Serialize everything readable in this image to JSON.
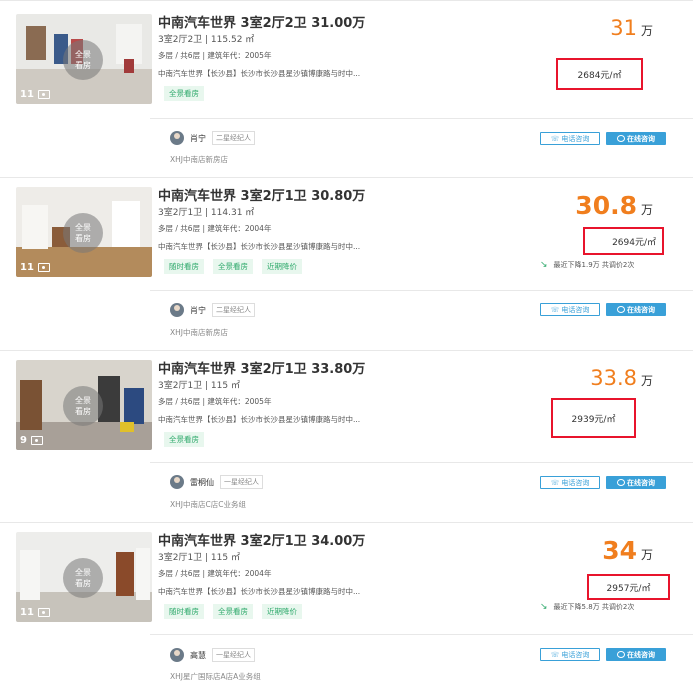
{
  "listings": [
    {
      "title": "中南汽车世界 3室2厅2卫 31.00万",
      "rooms": "3室2厅2卫 | 115.52 ㎡",
      "floor": "多层 / 共6层 | 建筑年代：2005年",
      "address": "中南汽车世界【长沙县】长沙市长沙县星沙镇博康路与时中...",
      "tags": [
        "全景看房"
      ],
      "photo_count": "11",
      "vr_label_line1": "全景",
      "vr_label_line2": "看房",
      "price": "31",
      "price_unit": "万",
      "unit_price": "2684元/㎡",
      "price_cut": "",
      "agent_name": "肖宁",
      "agent_level": "二星经纪人",
      "store": "XHJ中南店新房店",
      "phone_label": "电话咨询",
      "chat_label": "在线咨询"
    },
    {
      "title": "中南汽车世界 3室2厅1卫 30.80万",
      "rooms": "3室2厅1卫 | 114.31 ㎡",
      "floor": "多层 / 共6层 | 建筑年代：2004年",
      "address": "中南汽车世界【长沙县】长沙市长沙县星沙镇博康路与时中...",
      "tags": [
        "随时看房",
        "全景看房",
        "近期降价"
      ],
      "photo_count": "11",
      "vr_label_line1": "全景",
      "vr_label_line2": "看房",
      "price": "30.8",
      "price_unit": "万",
      "unit_price": "2694元/㎡",
      "price_cut": "最近下降1.9万  共调价2次",
      "agent_name": "肖宁",
      "agent_level": "二星经纪人",
      "store": "XHJ中南店新房店",
      "phone_label": "电话咨询",
      "chat_label": "在线咨询"
    },
    {
      "title": "中南汽车世界 3室2厅1卫 33.80万",
      "rooms": "3室2厅1卫 | 115 ㎡",
      "floor": "多层 / 共6层 | 建筑年代：2005年",
      "address": "中南汽车世界【长沙县】长沙市长沙县星沙镇博康路与时中...",
      "tags": [
        "全景看房"
      ],
      "photo_count": "9",
      "vr_label_line1": "全景",
      "vr_label_line2": "看房",
      "price": "33.8",
      "price_unit": "万",
      "unit_price": "2939元/㎡",
      "price_cut": "",
      "agent_name": "雷桐仙",
      "agent_level": "一星经纪人",
      "store": "XHJ中南店C店C业务组",
      "phone_label": "电话咨询",
      "chat_label": "在线咨询"
    },
    {
      "title": "中南汽车世界 3室2厅1卫 34.00万",
      "rooms": "3室2厅1卫 | 115 ㎡",
      "floor": "多层 / 共6层 | 建筑年代：2004年",
      "address": "中南汽车世界【长沙县】长沙市长沙县星沙镇博康路与时中...",
      "tags": [
        "随时看房",
        "全景看房",
        "近期降价"
      ],
      "photo_count": "11",
      "vr_label_line1": "全景",
      "vr_label_line2": "看房",
      "price": "34",
      "price_unit": "万",
      "unit_price": "2957元/㎡",
      "price_cut": "最近下降5.8万  共调价2次",
      "agent_name": "高慧",
      "agent_level": "一星经纪人",
      "store": "XHJ星广国际店A店A业务组",
      "phone_label": "电话咨询",
      "chat_label": "在线咨询"
    }
  ],
  "colors": {
    "price": "#f07e1e",
    "highlight_box": "#e8142c",
    "tag_text": "#2ea96b",
    "tag_bg": "#e8f7ee",
    "button_blue": "#39a0d8"
  },
  "icons": [
    "photo-icon",
    "phone-icon",
    "chat-icon",
    "price-down-arrow-icon",
    "vr-badge-icon"
  ]
}
